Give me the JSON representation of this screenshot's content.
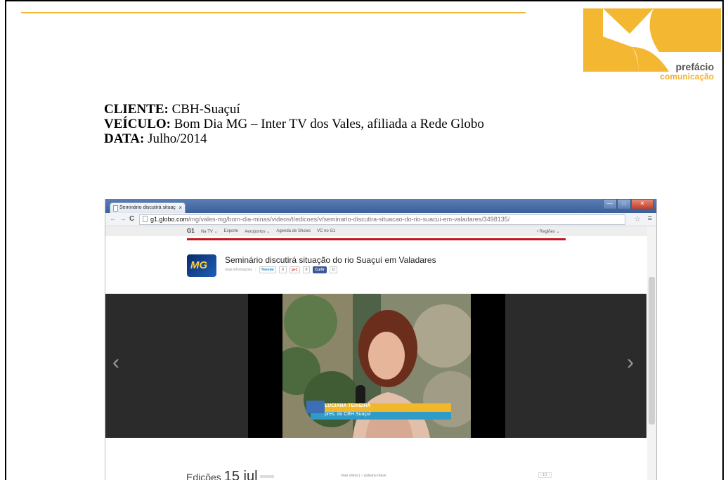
{
  "colors": {
    "gold": "#f4b731",
    "logo_text": "#555555",
    "accent_red": "#c4171c"
  },
  "logo": {
    "name": "prefácio",
    "sub": "comunicação"
  },
  "info": {
    "cliente_label": "CLIENTE:",
    "cliente_value": "CBH-Suaçuí",
    "veiculo_label": "VEÍCULO:",
    "veiculo_value": "Bom Dia MG – Inter TV dos Vales, afiliada a Rede Globo",
    "data_label": "DATA:",
    "data_value": "Julho/2014"
  },
  "browser": {
    "tab_title": "Seminário discutirá situaç",
    "tab_close": "×",
    "window_buttons": {
      "minimize": "—",
      "maximize": "□",
      "close": "✕"
    },
    "nav": {
      "back": "←",
      "forward": "→",
      "reload": "C"
    },
    "url_host": "g1.globo.com",
    "url_path": "/mg/vales-mg/bom-dia-minas/videos/t/edicoes/v/seminario-discutira-situacao-do-rio-suacui-em-valadares/3498135/",
    "star": "☆",
    "menu": "≡"
  },
  "g1_nav": {
    "logo": "G1",
    "items": [
      "Na TV ⌄",
      "Esporte",
      "Aeroportos ⌄",
      "Agenda de Shows",
      "VC no G1"
    ],
    "regioes": "• Regiões ⌄"
  },
  "article": {
    "logo_text": "MG",
    "title": "Seminário discutirá situação do rio Suaçuí em Valadares",
    "social": {
      "more_info": "mais informações",
      "tweet": "Tweetar",
      "tweet_count": "0",
      "gplus": "g+1",
      "gplus_count": "0",
      "fb": "Curtir",
      "fb_count": "0"
    }
  },
  "video": {
    "lower_third_name": "LUCIANA TEIXEIRA",
    "lower_third_role": "pres. do CBH Suaçuí",
    "prev_arrow": "‹",
    "next_arrow": "›"
  },
  "bottom": {
    "edicoes_label": "Edições",
    "edicoes_date": "15 jul",
    "search_hint": "mais vistos  |  ○ palavra-chave",
    "pager": "‹ 1/1 ›"
  }
}
